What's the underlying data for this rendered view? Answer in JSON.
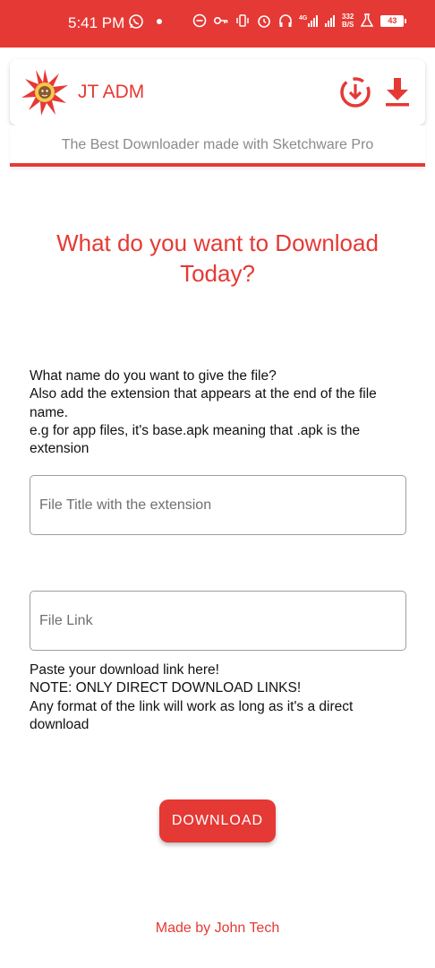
{
  "status_bar": {
    "time": "5:41 PM",
    "network_speed_value": "332",
    "network_speed_unit": "B/S",
    "network_type": "4G",
    "battery": "43",
    "icons": [
      "whatsapp-icon",
      "dot-icon",
      "minus-circle-icon",
      "key-icon",
      "vibrate-icon",
      "alarm-icon",
      "headset-icon",
      "signal-icon",
      "signal-icon",
      "flask-icon",
      "battery-icon"
    ]
  },
  "app_bar": {
    "title": "JT ADM",
    "icons": [
      "app-logo",
      "download-circle-icon",
      "download-icon"
    ]
  },
  "tagline": "The Best Downloader made with Sketchware Pro",
  "headline": "What do you want to Download Today?",
  "instructions": [
    "What name do you want to give the file?",
    "Also add the extension that appears at the end of the file name.",
    "e.g for app files, it's base.apk meaning that .apk is the extension"
  ],
  "file_title_input": {
    "placeholder": "File Title with the extension",
    "value": ""
  },
  "file_link_input": {
    "placeholder": "File Link",
    "value": ""
  },
  "paste_notes": [
    "Paste your download link here!",
    "NOTE: ONLY DIRECT DOWNLOAD LINKS!",
    "Any format of the link will work as long as it's a direct download"
  ],
  "download_button": "DOWNLOAD",
  "footer": "Made by John Tech",
  "colors": {
    "accent": "#e53935",
    "text": "#111111",
    "muted": "#8a8a8a"
  }
}
